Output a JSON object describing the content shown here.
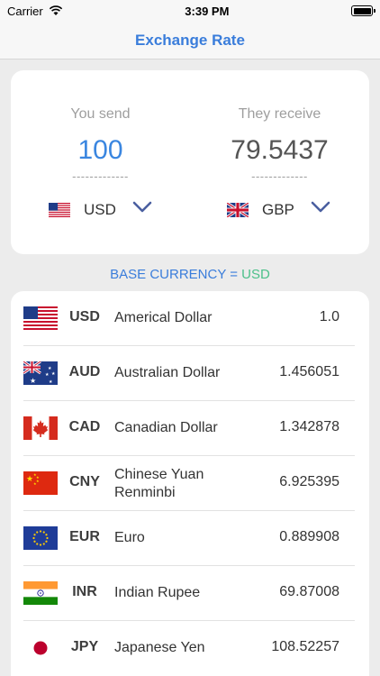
{
  "status_bar": {
    "carrier": "Carrier",
    "time": "3:39 PM"
  },
  "nav": {
    "title": "Exchange Rate"
  },
  "converter": {
    "send": {
      "label": "You send",
      "value": "100",
      "dashes": "-------------",
      "currency": "USD"
    },
    "receive": {
      "label": "They receive",
      "value": "79.5437",
      "dashes": "-------------",
      "currency": "GBP"
    },
    "accent_color": "#3a86e0"
  },
  "base_currency": {
    "label": "BASE CURRENCY = ",
    "code": "USD"
  },
  "rates": [
    {
      "code": "USD",
      "name": "Americal Dollar",
      "value": "1.0",
      "flag": "us-flag"
    },
    {
      "code": "AUD",
      "name": "Australian Dollar",
      "value": "1.456051",
      "flag": "au-flag"
    },
    {
      "code": "CAD",
      "name": "Canadian Dollar",
      "value": "1.342878",
      "flag": "ca-flag"
    },
    {
      "code": "CNY",
      "name": "Chinese Yuan Renminbi",
      "value": "6.925395",
      "flag": "cn-flag"
    },
    {
      "code": "EUR",
      "name": "Euro",
      "value": "0.889908",
      "flag": "eu-flag"
    },
    {
      "code": "INR",
      "name": "Indian Rupee",
      "value": "69.87008",
      "flag": "in-flag"
    },
    {
      "code": "JPY",
      "name": "Japanese Yen",
      "value": "108.52257",
      "flag": "jp-flag"
    }
  ]
}
